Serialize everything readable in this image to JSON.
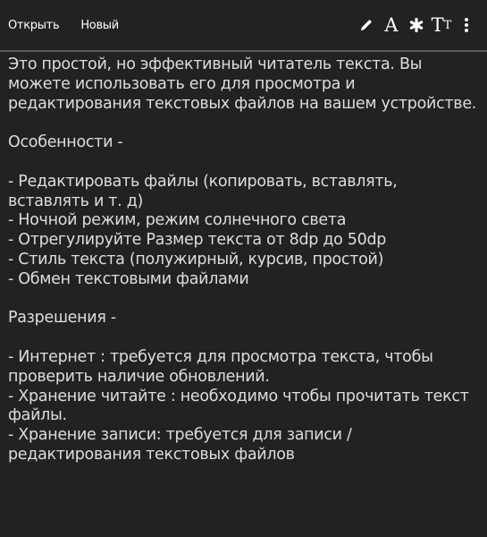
{
  "toolbar": {
    "open_label": "Открыть",
    "new_label": "Новый",
    "font_icon_glyph": "A",
    "style_icon_glyph": "✱",
    "textsize_icon_big": "T",
    "textsize_icon_small": "T",
    "more_icon_glyph": "⋮"
  },
  "content": {
    "intro": "Это простой, но эффективный читатель текста. Вы можете использовать его для просмотра и редактирования текстовых файлов на вашем устройстве.",
    "features_heading": "Особенности -",
    "features": [
      "- Редактировать файлы (копировать, вставлять, вставлять и т. д)",
      "- Ночной режим, режим солнечного света",
      "- Отрегулируйте Размер текста от 8dp до 50dp",
      "- Стиль текста (полужирный, курсив, простой)",
      "- Обмен текстовыми файлами"
    ],
    "permissions_heading": "Разрешения -",
    "permissions": [
      "- Интернет : требуется для просмотра текста, чтобы проверить наличие обновлений.",
      "- Хранение читайте : необходимо чтобы прочитать текст файлы.",
      "- Хранение записи: требуется для записи / редактирования текстовых файлов"
    ]
  },
  "colors": {
    "background": "#222222",
    "text": "#dddddd",
    "toolbar_text": "#ffffff",
    "divider": "#5a5a5a"
  }
}
